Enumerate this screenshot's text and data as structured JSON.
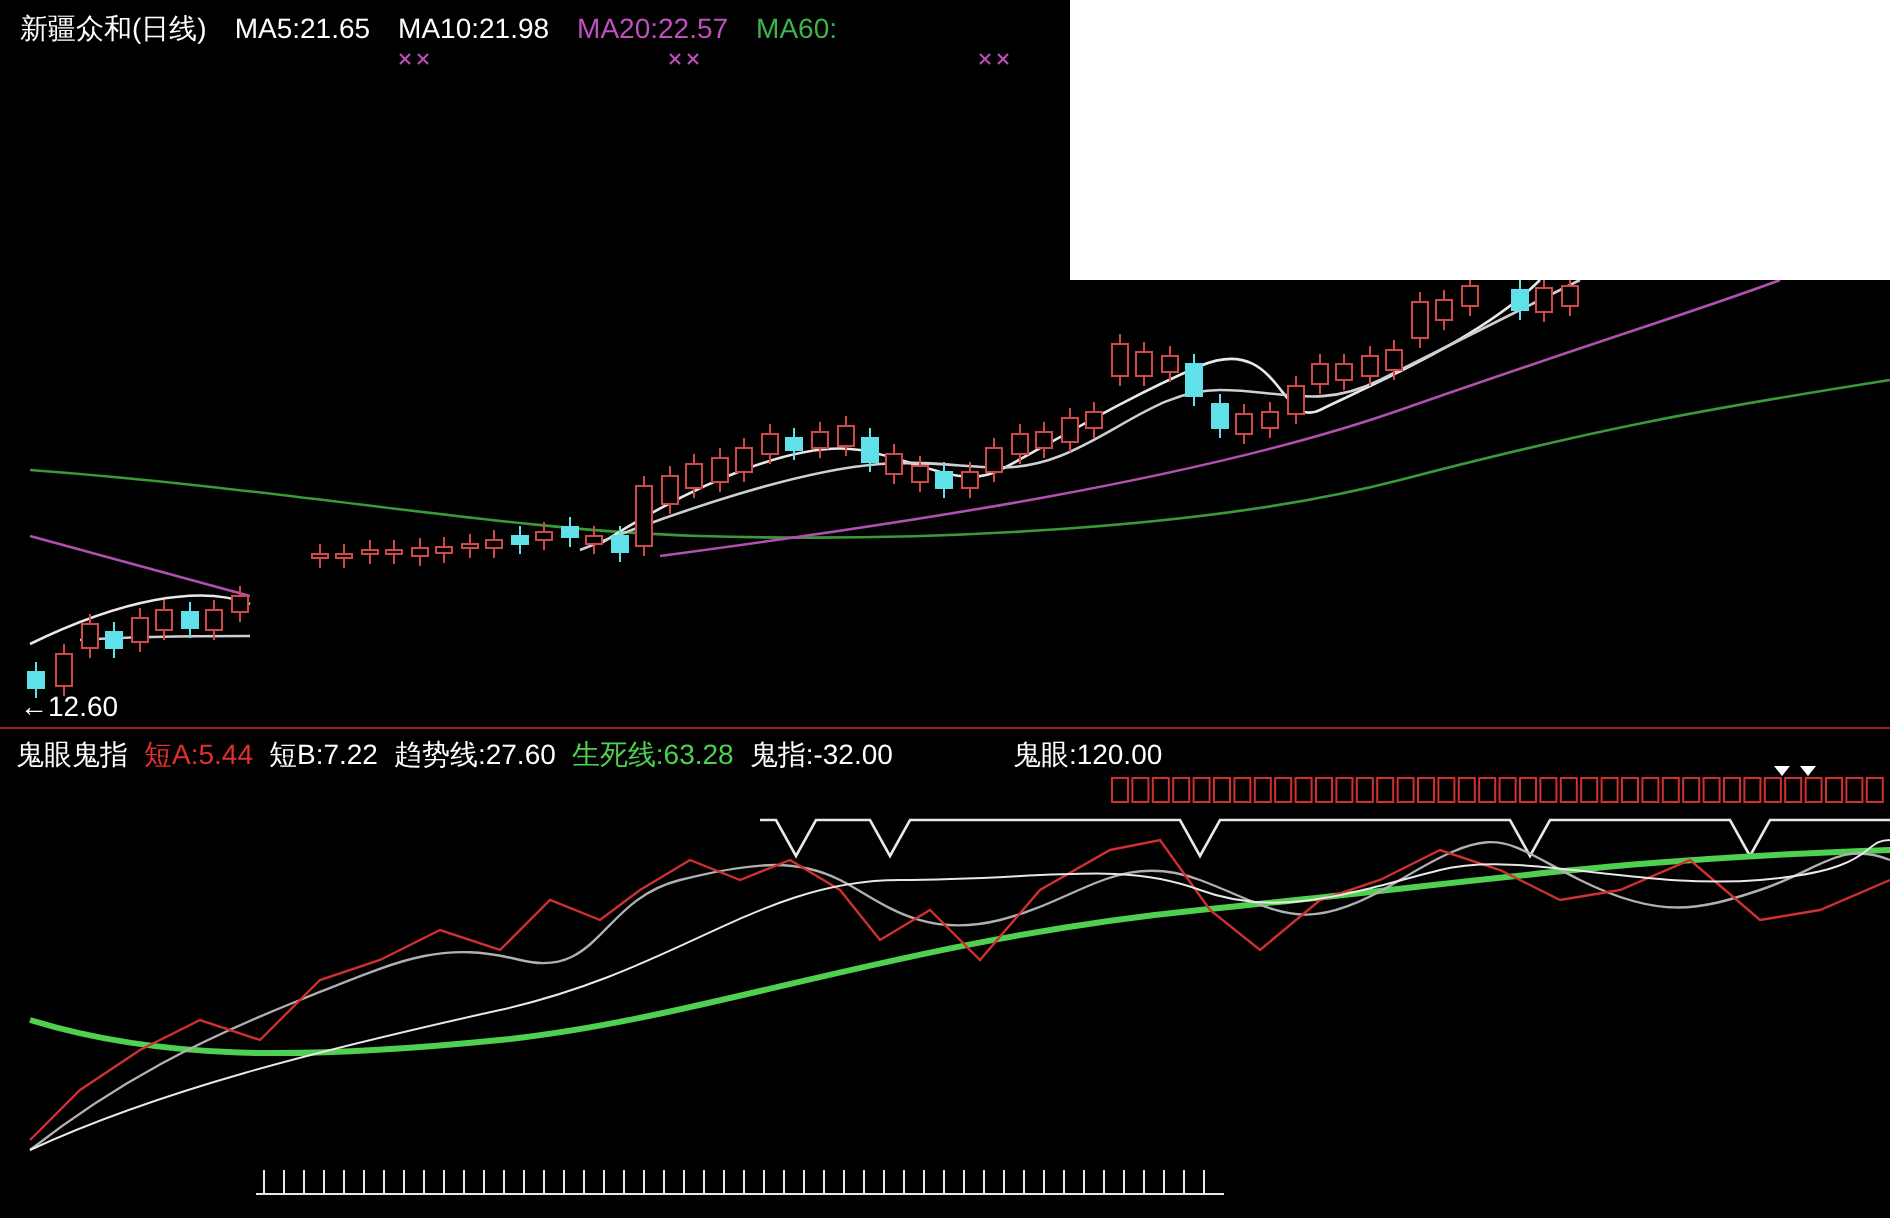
{
  "header": {
    "title": "新疆众和(日线)",
    "indicators": [
      {
        "label": "MA5:21.65",
        "color": "#ffffff"
      },
      {
        "label": "MA10:21.98",
        "color": "#ffffff"
      },
      {
        "label": "MA20:22.57",
        "color": "#c050c0"
      },
      {
        "label": "MA60:",
        "color": "#3cb44b"
      }
    ]
  },
  "price_label": "←12.60",
  "indicator_panel": {
    "title": "鬼眼鬼指",
    "legend": [
      {
        "label": "短A:5.44",
        "color": "#e03030"
      },
      {
        "label": "短B:7.22",
        "color": "#ffffff"
      },
      {
        "label": "趋势线:27.60",
        "color": "#ffffff"
      },
      {
        "label": "生死线:63.28",
        "color": "#50d050"
      },
      {
        "label": "鬼指:-32.00",
        "color": "#ffffff"
      },
      {
        "label": "鬼眼:120.00",
        "color": "#ffffff"
      }
    ]
  }
}
